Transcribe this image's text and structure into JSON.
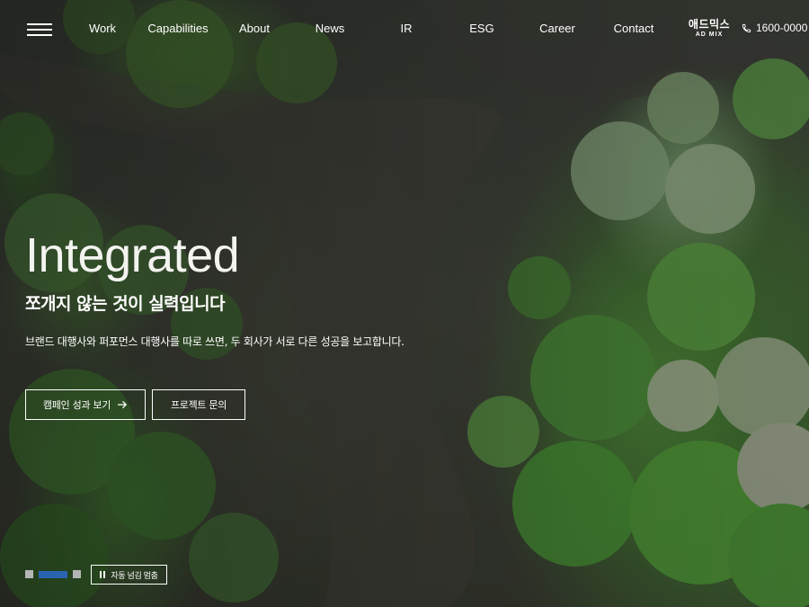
{
  "header": {
    "nav": [
      {
        "label": "Work"
      },
      {
        "label": "Capabilities"
      },
      {
        "label": "About"
      },
      {
        "label": "News"
      },
      {
        "label": "IR"
      },
      {
        "label": "ESG"
      },
      {
        "label": "Career"
      },
      {
        "label": "Contact"
      }
    ],
    "logo": {
      "korean": "애드믹스",
      "english": "AD MIX"
    },
    "phone": "1600-0000"
  },
  "hero": {
    "title": "Integrated",
    "subtitle": "쪼개지 않는 것이 실력입니다",
    "description": "브랜드 대행사와 퍼포먼스 대행사를 따로 쓰면, 두 회사가 서로 다른 성공을 보고합니다.",
    "primary_button": "캠페인 성과 보기",
    "secondary_button": "프로젝트 문의"
  },
  "slider": {
    "slide_count": 3,
    "active_index": 1,
    "autoplay_label": "자동 넘김 멈춤"
  },
  "colors": {
    "accent": "#2b63b3",
    "inactive_dot": "#b5b5b5"
  },
  "icons": [
    "menu-icon",
    "phone-icon",
    "arrow-right-icon",
    "pause-icon"
  ]
}
